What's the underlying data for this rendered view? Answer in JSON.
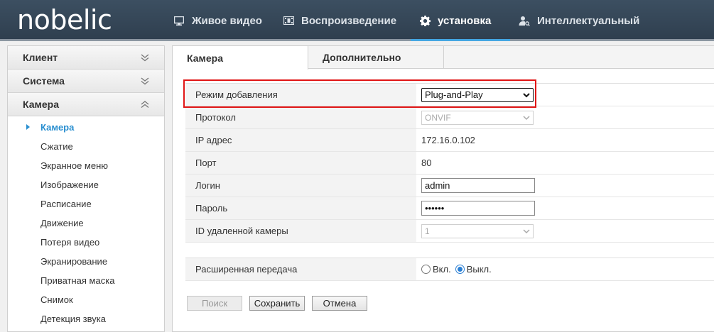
{
  "brand": {
    "logo": "nobelic"
  },
  "nav": [
    {
      "label": "Живое видео",
      "icon": "monitor-icon"
    },
    {
      "label": "Воспроизведение",
      "icon": "film-icon"
    },
    {
      "label": "установка",
      "icon": "gear-icon",
      "active": true
    },
    {
      "label": "Интеллектуальный",
      "icon": "person-search-icon"
    }
  ],
  "sidebar": {
    "groups": [
      {
        "label": "Клиент",
        "expanded": false
      },
      {
        "label": "Система",
        "expanded": false
      },
      {
        "label": "Камера",
        "expanded": true
      }
    ],
    "items": [
      "Камера",
      "Сжатие",
      "Экранное меню",
      "Изображение",
      "Расписание",
      "Движение",
      "Потеря видео",
      "Экранирование",
      "Приватная маска",
      "Снимок",
      "Детекция звука"
    ],
    "active_item": "Камера"
  },
  "tabs": [
    {
      "label": "Камера",
      "active": true
    },
    {
      "label": "Дополнительно",
      "active": false
    }
  ],
  "form": {
    "add_mode": {
      "label": "Режим добавления",
      "value": "Plug-and-Play"
    },
    "protocol": {
      "label": "Протокол",
      "value": "ONVIF"
    },
    "ip": {
      "label": "IP адрес",
      "value": "172.16.0.102"
    },
    "port": {
      "label": "Порт",
      "value": "80"
    },
    "login": {
      "label": "Логин",
      "value": "admin"
    },
    "password": {
      "label": "Пароль",
      "value": "••••••"
    },
    "remote_id": {
      "label": "ID удаленной камеры",
      "value": "1"
    },
    "ext_transfer": {
      "label": "Расширенная передача",
      "on_label": "Вкл.",
      "off_label": "Выкл.",
      "selected": "off"
    }
  },
  "buttons": {
    "search": "Поиск",
    "save": "Сохранить",
    "cancel": "Отмена"
  },
  "colors": {
    "topbar": "#34475a",
    "accent": "#44a6e2",
    "active_link": "#2a8fd0",
    "highlight_box": "#e01515"
  }
}
